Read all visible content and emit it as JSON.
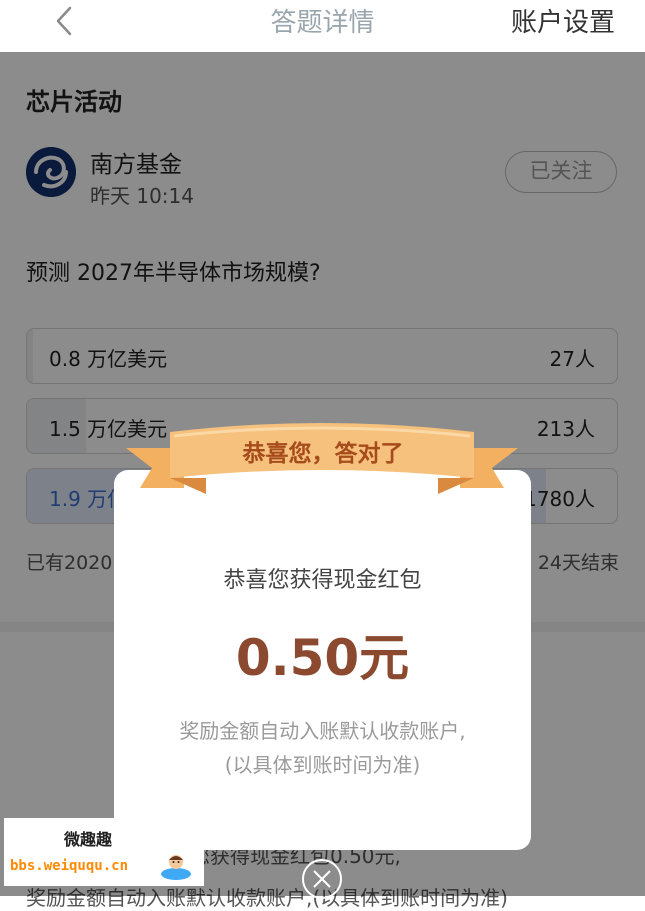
{
  "nav": {
    "title": "答题详情",
    "settings": "账户设置"
  },
  "section_title": "芯片活动",
  "publisher": {
    "name": "南方基金",
    "time": "昨天 10:14",
    "follow_label": "已关注"
  },
  "question": "预测 2027年半导体市场规模?",
  "options": [
    {
      "label": "0.8 万亿美元",
      "count": "27人",
      "share": 0.01
    },
    {
      "label": "1.5 万亿美元",
      "count": "213人",
      "share": 0.1
    },
    {
      "label": "1.9 万亿美元",
      "count": "1780人",
      "share": 0.88,
      "selected": true
    }
  ],
  "stats": {
    "left": "已有2020",
    "right": "24天结束"
  },
  "background_text": {
    "line1": "恭喜您获得现金红包0.50元,",
    "line2": "奖励金额自动入账默认收款账户,(以具体到账时间为准)"
  },
  "modal": {
    "ribbon": "恭喜您，答对了",
    "message": "恭喜您获得现金红包",
    "amount": "0.50元",
    "note_line1": "奖励金额自动入账默认收款账户,",
    "note_line2": "(以具体到账时间为准)"
  },
  "watermark": {
    "top": "微趣趣",
    "bottom": "bbs.weiququ.cn"
  },
  "colors": {
    "amount": "#8b4a2f",
    "ribbon": "#f6c07d",
    "selected_text": "#3b6fd0",
    "logo": "#13316e"
  }
}
